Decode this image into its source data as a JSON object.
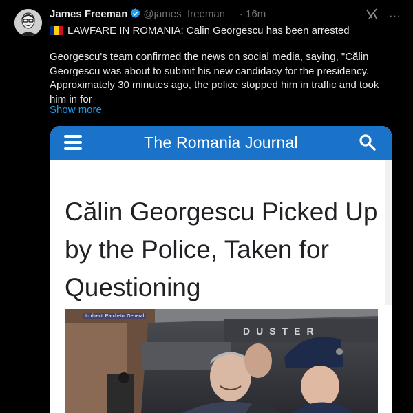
{
  "author": {
    "display_name": "James Freeman",
    "handle": "@james_freeman__",
    "time": "· 16m"
  },
  "top_icons": {
    "grok_icon": "grok-icon",
    "more_icon": "···"
  },
  "tweet": {
    "headline": "LAWFARE IN ROMANIA: Calin Georgescu has been arrested",
    "body": "Georgescu's team confirmed the news on social media, saying, \"Călin Georgescu was about to submit his new candidacy for the presidency. Approximately 30 minutes ago, the police stopped him in traffic and took him in for",
    "show_more": "Show more"
  },
  "media": {
    "site_name": "The Romania Journal",
    "article_title": "Călin Georgescu Picked Up by the Police, Taken for Questioning",
    "photo_caption": "In direct. Parchetul General",
    "vehicle_text": "DUSTER"
  },
  "colors": {
    "background": "#000000",
    "accent": "#1d9bf0",
    "site_bar": "#1a73c9",
    "flag": [
      "#002b7f",
      "#fcd116",
      "#ce1126"
    ]
  }
}
